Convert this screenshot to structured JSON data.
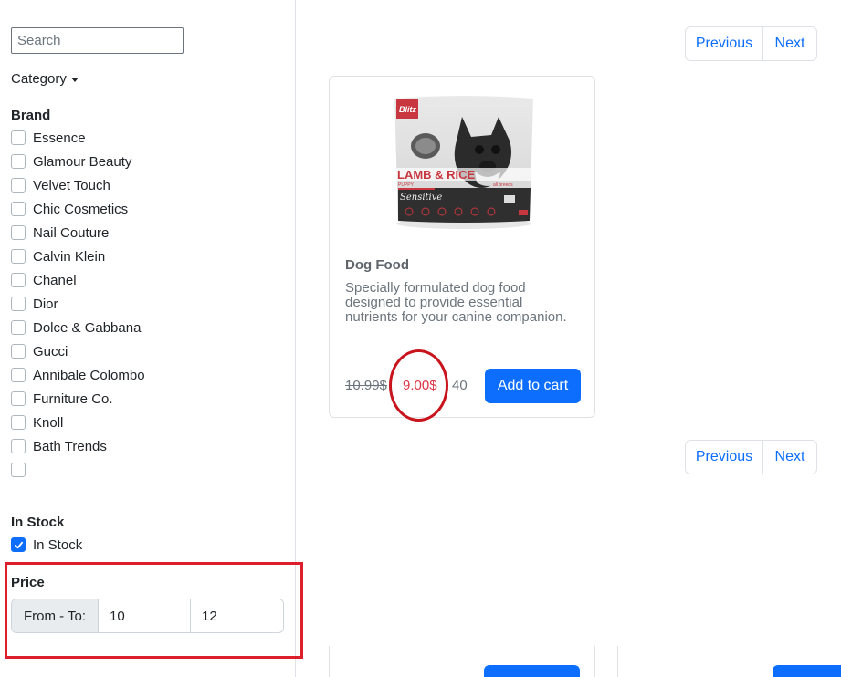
{
  "sidebar": {
    "search_placeholder": "Search",
    "category_label": "Category",
    "brand_title": "Brand",
    "brands": [
      {
        "label": "Essence",
        "checked": false
      },
      {
        "label": "Glamour Beauty",
        "checked": false
      },
      {
        "label": "Velvet Touch",
        "checked": false
      },
      {
        "label": "Chic Cosmetics",
        "checked": false
      },
      {
        "label": "Nail Couture",
        "checked": false
      },
      {
        "label": "Calvin Klein",
        "checked": false
      },
      {
        "label": "Chanel",
        "checked": false
      },
      {
        "label": "Dior",
        "checked": false
      },
      {
        "label": "Dolce & Gabbana",
        "checked": false
      },
      {
        "label": "Gucci",
        "checked": false
      },
      {
        "label": "Annibale Colombo",
        "checked": false
      },
      {
        "label": "Furniture Co.",
        "checked": false
      },
      {
        "label": "Knoll",
        "checked": false
      },
      {
        "label": "Bath Trends",
        "checked": false
      },
      {
        "label": "",
        "checked": false
      }
    ],
    "instock_title": "In Stock",
    "instock_label": "In Stock",
    "instock_checked": true,
    "price_title": "Price",
    "price_addon": "From - To:",
    "price_from": "10",
    "price_to": "12"
  },
  "pagination": {
    "previous": "Previous",
    "next": "Next"
  },
  "product": {
    "image_brand": "Blitz",
    "image_flavor": "LAMB & RICE",
    "image_sub": "PUPPY",
    "image_note": "all breeds",
    "image_line": "Sensitive",
    "title": "Dog Food",
    "description": "Specially formulated dog food designed to provide essential nutrients for your canine companion.",
    "old_price": "10.99$",
    "new_price": "9.00$",
    "stock": "40",
    "add_to_cart": "Add to cart"
  },
  "colors": {
    "primary": "#0d6efd",
    "sale": "#dc3545",
    "highlight": "#dc1f2b"
  }
}
